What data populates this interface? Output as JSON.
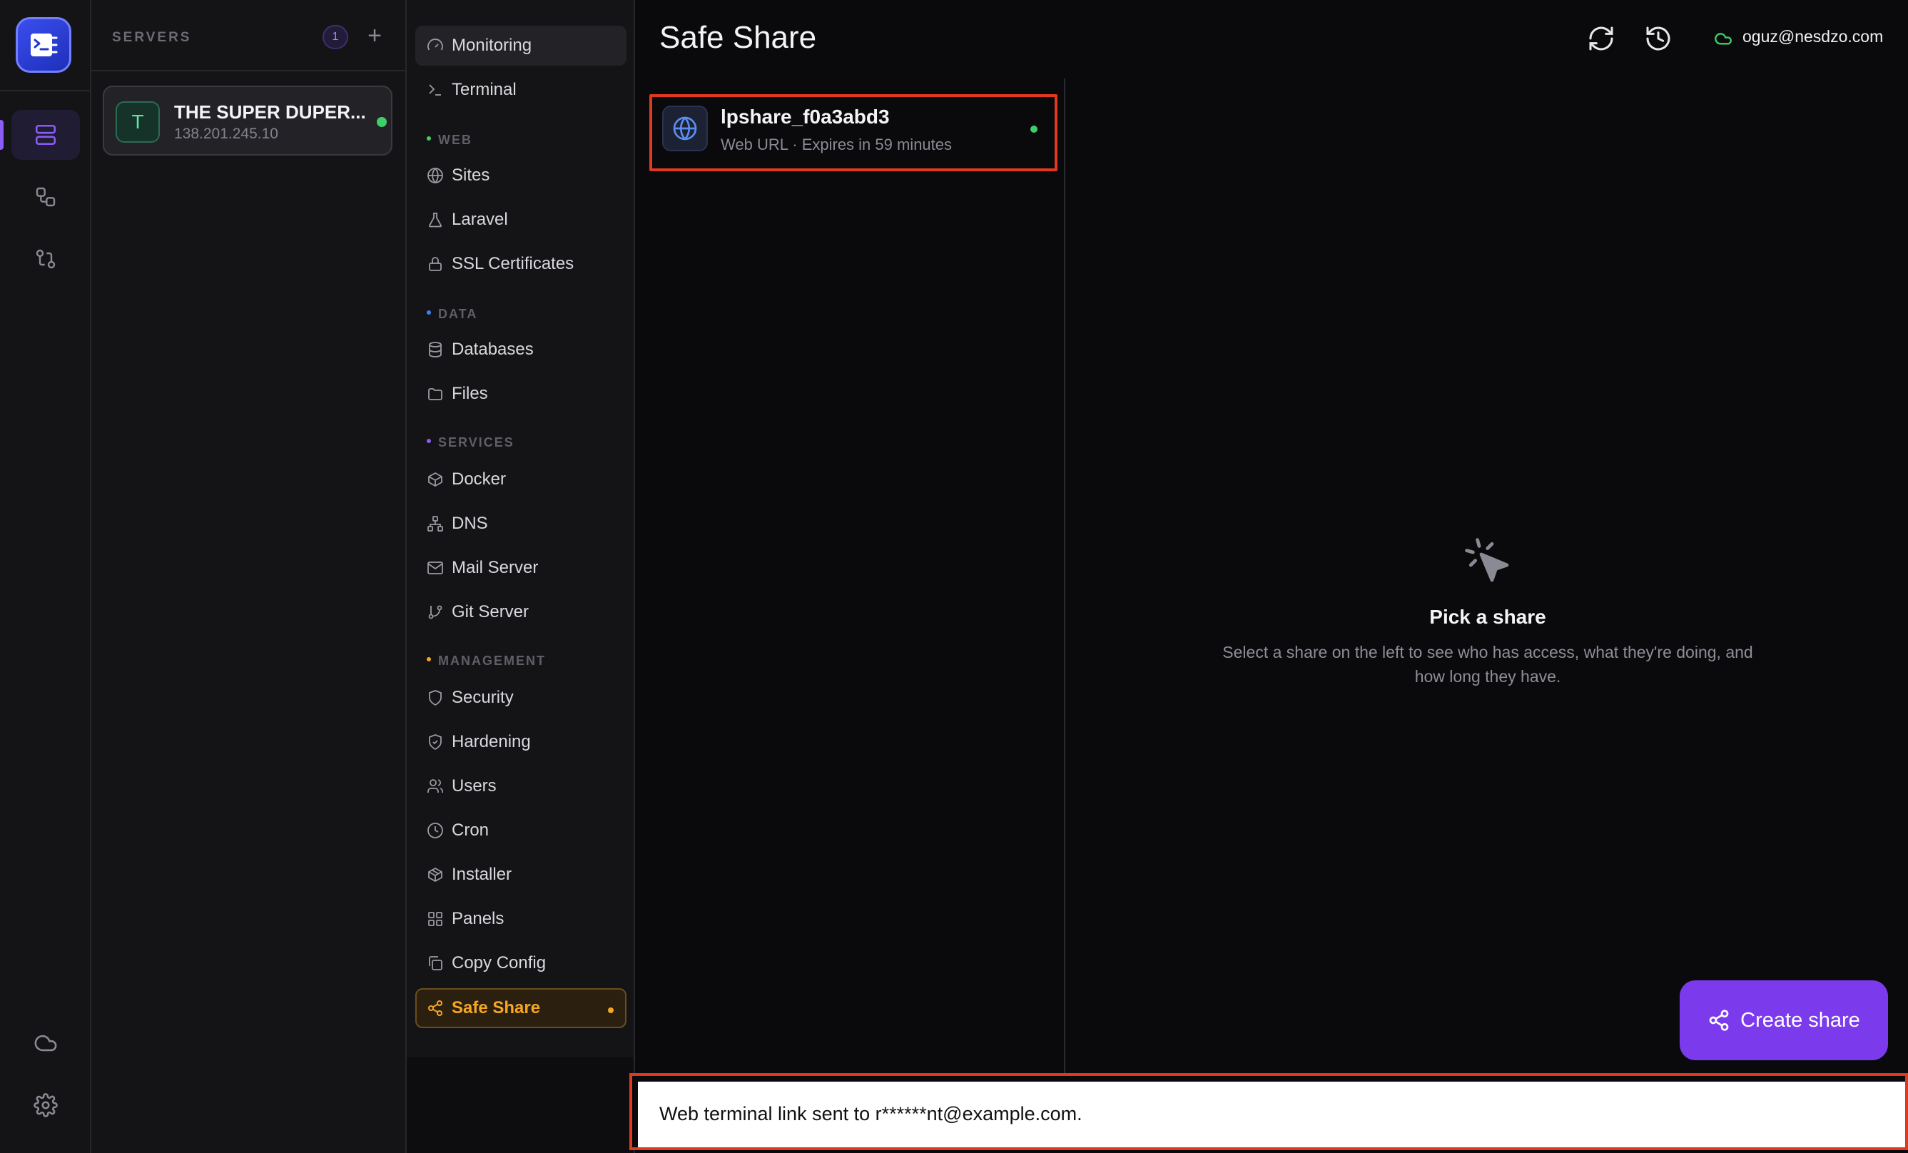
{
  "sidebar_servers": {
    "title": "SERVERS",
    "count": "1",
    "add": "+",
    "server": {
      "initial": "T",
      "name": "THE SUPER DUPER...",
      "ip": "138.201.245.10",
      "status_color": "#3ecf6a"
    }
  },
  "rail": {
    "icons": [
      "app-logo-icon",
      "servers-icon",
      "workflow-icon",
      "git-compare-icon",
      "cloud-icon",
      "settings-icon"
    ]
  },
  "nav": {
    "items_top": [
      {
        "label": "Monitoring",
        "icon": "gauge-icon"
      },
      {
        "label": "Terminal",
        "icon": "terminal-icon"
      }
    ],
    "sections": [
      {
        "title": "WEB",
        "dot_color": "#3ecf6a",
        "items": [
          {
            "label": "Sites",
            "icon": "globe-icon"
          },
          {
            "label": "Laravel",
            "icon": "flask-icon"
          },
          {
            "label": "SSL Certificates",
            "icon": "lock-icon"
          }
        ]
      },
      {
        "title": "DATA",
        "dot_color": "#3b82f6",
        "items": [
          {
            "label": "Databases",
            "icon": "database-icon"
          },
          {
            "label": "Files",
            "icon": "folder-icon"
          }
        ]
      },
      {
        "title": "SERVICES",
        "dot_color": "#8b5cf6",
        "items": [
          {
            "label": "Docker",
            "icon": "box-icon"
          },
          {
            "label": "DNS",
            "icon": "network-icon"
          },
          {
            "label": "Mail Server",
            "icon": "mail-icon"
          },
          {
            "label": "Git Server",
            "icon": "git-branch-icon"
          }
        ]
      },
      {
        "title": "MANAGEMENT",
        "dot_color": "#f5a623",
        "items": [
          {
            "label": "Security",
            "icon": "shield-icon"
          },
          {
            "label": "Hardening",
            "icon": "shield-check-icon"
          },
          {
            "label": "Users",
            "icon": "users-icon"
          },
          {
            "label": "Cron",
            "icon": "clock-icon"
          },
          {
            "label": "Installer",
            "icon": "package-icon"
          },
          {
            "label": "Panels",
            "icon": "grid-icon"
          },
          {
            "label": "Copy Config",
            "icon": "copy-icon"
          },
          {
            "label": "Safe Share",
            "icon": "share-icon"
          }
        ]
      }
    ]
  },
  "header": {
    "title": "Safe Share",
    "account": "oguz@nesdzo.com"
  },
  "shares": [
    {
      "name": "lpshare_f0a3abd3",
      "subtitle": "Web URL · Expires in 59 minutes",
      "status_color": "#3ecf6a"
    }
  ],
  "empty_state": {
    "title": "Pick a share",
    "text": "Select a share on the left to see who has access, what they're doing, and how long they have."
  },
  "create_button": {
    "label": "Create share"
  },
  "toast": {
    "text": "Web terminal link sent to r******nt@example.com."
  },
  "colors": {
    "accent": "#7c3aed",
    "selected": "#f5a623",
    "highlight": "#e0391f"
  }
}
